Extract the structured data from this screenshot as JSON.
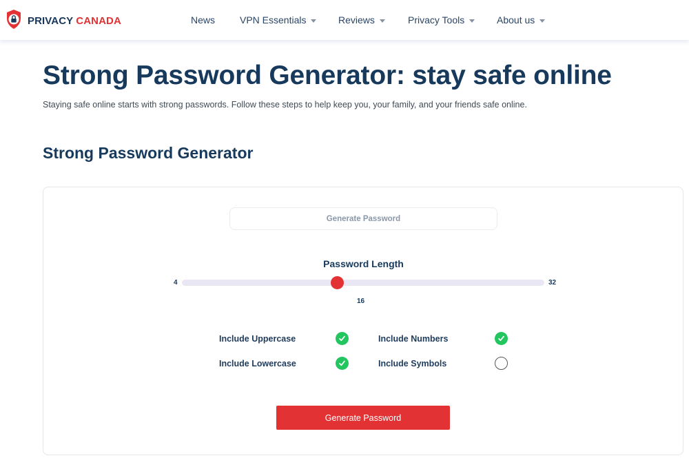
{
  "header": {
    "logo": {
      "part1": "PRIVACY",
      "part2": "CANADA",
      "icon": "shield-lock-icon"
    },
    "nav": [
      {
        "label": "News",
        "has_dropdown": false
      },
      {
        "label": "VPN Essentials",
        "has_dropdown": true
      },
      {
        "label": "Reviews",
        "has_dropdown": true
      },
      {
        "label": "Privacy Tools",
        "has_dropdown": true
      },
      {
        "label": "About us",
        "has_dropdown": true
      }
    ]
  },
  "page": {
    "title": "Strong Password Generator: stay safe online",
    "subtitle": "Staying safe online starts with strong passwords. Follow these steps to help keep you, your family, and your friends safe online.",
    "section_title": "Strong Password Generator"
  },
  "generator": {
    "output_placeholder": "Generate Password",
    "length": {
      "label": "Password Length",
      "min": 4,
      "max": 32,
      "value": 16
    },
    "options": [
      {
        "label": "Include Uppercase",
        "checked": true
      },
      {
        "label": "Include Numbers",
        "checked": true
      },
      {
        "label": "Include Lowercase",
        "checked": true
      },
      {
        "label": "Include Symbols",
        "checked": false
      }
    ],
    "button_label": "Generate Password"
  },
  "colors": {
    "brand_navy": "#16395c",
    "brand_red": "#e23234",
    "check_green": "#22c55e",
    "track": "#e9e7f3"
  }
}
